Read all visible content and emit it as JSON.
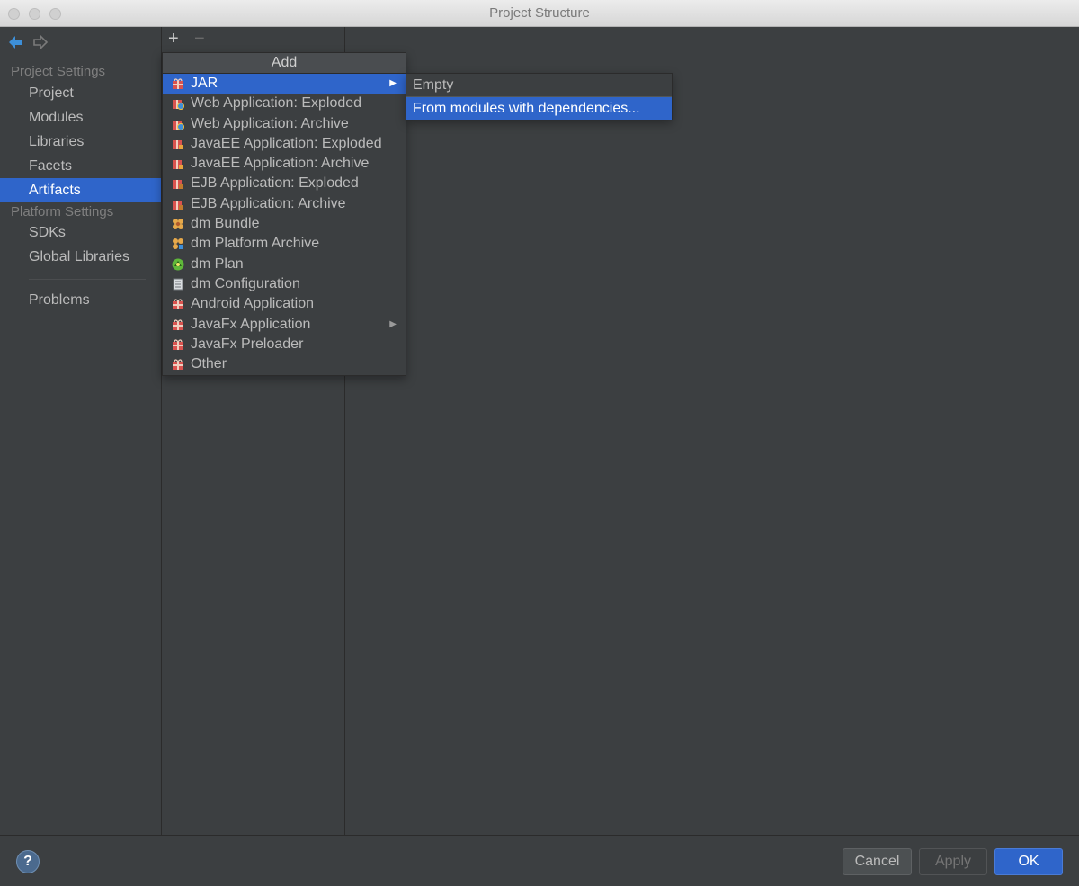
{
  "window": {
    "title": "Project Structure"
  },
  "sidebar": {
    "project_settings_header": "Project Settings",
    "project_items": [
      {
        "label": "Project"
      },
      {
        "label": "Modules"
      },
      {
        "label": "Libraries"
      },
      {
        "label": "Facets"
      },
      {
        "label": "Artifacts",
        "selected": true
      }
    ],
    "platform_settings_header": "Platform Settings",
    "platform_items": [
      {
        "label": "SDKs"
      },
      {
        "label": "Global Libraries"
      }
    ],
    "problems_label": "Problems"
  },
  "toolbar": {
    "add_symbol": "+",
    "remove_symbol": "−"
  },
  "add_menu": {
    "header": "Add",
    "items": [
      {
        "label": "JAR",
        "icon": "jar-gift-icon",
        "submenu": true,
        "selected": true
      },
      {
        "label": "Web Application: Exploded",
        "icon": "web-app-icon"
      },
      {
        "label": "Web Application: Archive",
        "icon": "web-app-icon"
      },
      {
        "label": "JavaEE Application: Exploded",
        "icon": "javaee-icon"
      },
      {
        "label": "JavaEE Application: Archive",
        "icon": "javaee-icon"
      },
      {
        "label": "EJB Application: Exploded",
        "icon": "ejb-icon"
      },
      {
        "label": "EJB Application: Archive",
        "icon": "ejb-icon"
      },
      {
        "label": "dm Bundle",
        "icon": "dm-bundle-icon"
      },
      {
        "label": "dm Platform Archive",
        "icon": "dm-platform-icon"
      },
      {
        "label": "dm Plan",
        "icon": "dm-plan-icon"
      },
      {
        "label": "dm Configuration",
        "icon": "dm-config-icon"
      },
      {
        "label": "Android Application",
        "icon": "android-gift-icon"
      },
      {
        "label": "JavaFx Application",
        "icon": "javafx-gift-icon",
        "submenu": true
      },
      {
        "label": "JavaFx Preloader",
        "icon": "javafx-preloader-icon"
      },
      {
        "label": "Other",
        "icon": "other-gift-icon"
      }
    ]
  },
  "jar_submenu": {
    "items": [
      {
        "label": "Empty"
      },
      {
        "label": "From modules with dependencies...",
        "selected": true
      }
    ]
  },
  "footer": {
    "help_label": "?",
    "cancel_label": "Cancel",
    "apply_label": "Apply",
    "ok_label": "OK"
  },
  "colors": {
    "background": "#3c3f41",
    "selection": "#2f65ca",
    "text": "#bbbbbb",
    "muted_text": "#7f7f7f"
  }
}
